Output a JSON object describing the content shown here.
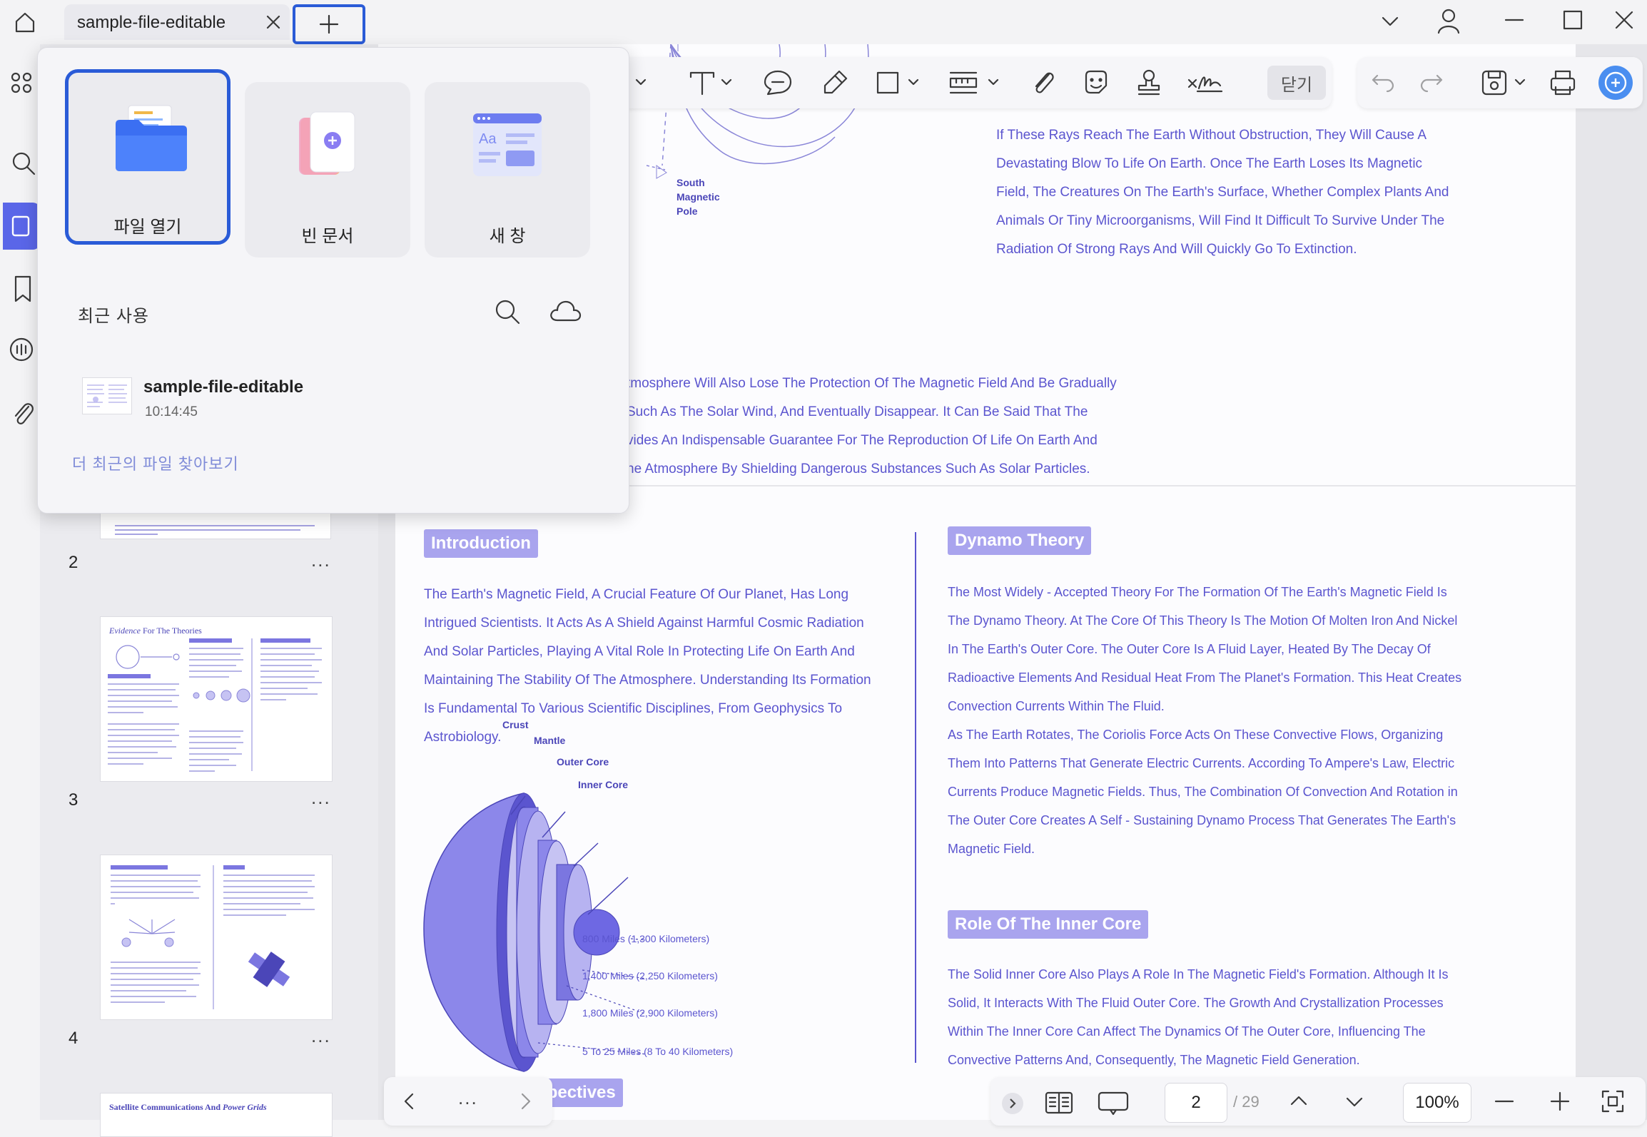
{
  "tab": {
    "title": "sample-file-editable"
  },
  "toolbar": {
    "close_label": "닫기"
  },
  "popup": {
    "cards": [
      {
        "label": "파일 열기"
      },
      {
        "label": "빈 문서"
      },
      {
        "label": "새 창"
      }
    ],
    "recent_title": "최근 사용",
    "recent_files": [
      {
        "name": "sample-file-editable",
        "time": "10:14:45"
      }
    ],
    "more_link": "더 최근의 파일 찾아보기"
  },
  "thumbnails": [
    {
      "num": "2",
      "more": "..."
    },
    {
      "num": "3",
      "more": "...",
      "title_italic": "Evidence",
      "title_rest": " For The Theories"
    },
    {
      "num": "4",
      "more": "..."
    },
    {
      "num": "",
      "title_rest": "Satellite Communications And ",
      "title_italic": "Power Grids"
    }
  ],
  "document": {
    "upper_text_right": [
      "If These Rays Reach The Earth Without Obstruction, They Will Cause A",
      "Devastating Blow To Life On Earth. Once The Earth Loses Its Magnetic",
      "Field, The Creatures On The Earth's Surface, Whether Complex Plants And",
      "Animals Or Tiny Microorganisms, Will Find It Difficult To Survive Under The",
      "Radiation Of Strong Rays And Will Quickly Go To Extinction."
    ],
    "upper_text_left": [
      "tmosphere Will Also Lose The Protection Of The Magnetic Field And Be Gradually",
      "Such As The Solar Wind, And Eventually Disappear. It Can Be Said That The",
      "vides An Indispensable Guarantee For The Reproduction Of Life On Earth And",
      "he Atmosphere By Shielding Dangerous Substances Such As Solar Particles."
    ],
    "south_pole_label": [
      "South",
      "Magnetic",
      "Pole"
    ],
    "intro_heading": "Introduction",
    "intro_text": [
      "The Earth's Magnetic Field, A Crucial Feature Of Our Planet, Has Long",
      "Intrigued Scientists. It Acts As A Shield Against Harmful Cosmic Radiation",
      "And Solar Particles, Playing A Vital Role In Protecting Life On Earth And",
      "Maintaining The Stability Of The Atmosphere. Understanding Its Formation",
      "Is Fundamental To Various Scientific Disciplines, From Geophysics To",
      "Astrobiology."
    ],
    "layers": {
      "crust": "Crust",
      "mantle": "Mantle",
      "outer_core": "Outer Core",
      "inner_core": "Inner Core",
      "d1": "800 Miles (1,300 Kilometers)",
      "d2": "1,400 Miles (2,250 Kilometers)",
      "d3": "1,800 Miles (2,900 Kilometers)",
      "d4": "5 To 25 Miles (8 To 40 Kilometers)"
    },
    "dynamo_heading": "Dynamo Theory",
    "dynamo_text": [
      "The Most Widely - Accepted Theory For The Formation Of The Earth's Magnetic Field Is",
      "The Dynamo Theory. At The Core Of This Theory Is The Motion Of Molten Iron And Nickel",
      "In The Earth's Outer Core. The Outer Core Is A Fluid Layer, Heated By The Decay Of",
      "Radioactive Elements And Residual Heat From The Planet's Formation. This Heat Creates",
      "Convection Currents Within The Fluid.",
      "As The Earth Rotates, The Coriolis Force Acts On These Convective Flows, Organizing",
      "Them Into Patterns That Generate Electric Currents. According To Ampere's Law, Electric",
      "Currents Produce Magnetic Fields. Thus, The Combination Of Convection And Rotation in",
      "The Outer Core Creates A Self - Sustaining Dynamo Process That Generates The Earth's",
      "Magnetic Field."
    ],
    "inner_core_heading": "Role Of The Inner Core",
    "inner_core_text": [
      "The Solid Inner Core Also Plays A Role In The Magnetic Field's Formation. Although It Is",
      "Solid, It Interacts With The Fluid Outer Core. The Growth And Crystallization Processes",
      "Within The Inner Core Can Affect The Dynamics Of The Outer Core, Influencing The",
      "Convective Patterns And, Consequently, The Magnetic Field Generation."
    ],
    "partial_heading": "rspectives"
  },
  "bottom_left": {
    "more": "..."
  },
  "pagination": {
    "current": "2",
    "total": "/ 29",
    "zoom": "100%"
  },
  "colors": {
    "accent": "#2a5bd7",
    "doc_text": "#5b55cf",
    "chip": "#a9a4ee"
  }
}
